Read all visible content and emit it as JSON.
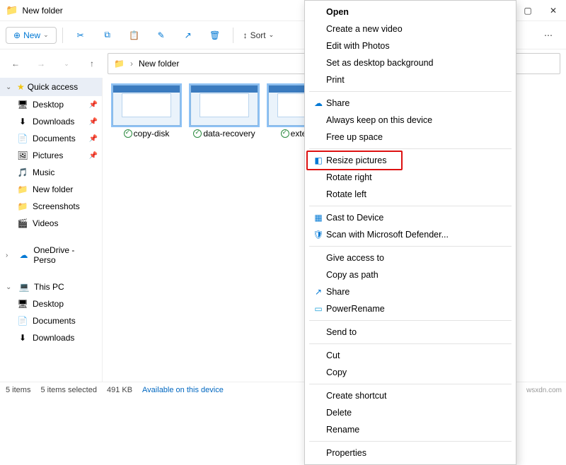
{
  "titlebar": {
    "title": "New folder"
  },
  "toolbar": {
    "new_label": "New",
    "sort_label": "Sort"
  },
  "breadcrumb": {
    "label": "New folder"
  },
  "sidebar": {
    "quick_access": "Quick access",
    "items": [
      {
        "label": "Desktop"
      },
      {
        "label": "Downloads"
      },
      {
        "label": "Documents"
      },
      {
        "label": "Pictures"
      },
      {
        "label": "Music"
      },
      {
        "label": "New folder"
      },
      {
        "label": "Screenshots"
      },
      {
        "label": "Videos"
      }
    ],
    "onedrive": "OneDrive - Perso",
    "thispc": "This PC",
    "pc_items": [
      {
        "label": "Desktop"
      },
      {
        "label": "Documents"
      },
      {
        "label": "Downloads"
      }
    ]
  },
  "files": [
    {
      "name": "copy-disk"
    },
    {
      "name": "data-recovery"
    },
    {
      "name": "extend-n"
    }
  ],
  "status": {
    "count": "5 items",
    "sel": "5 items selected",
    "size": "491 KB",
    "avail": "Available on this device"
  },
  "watermark": "wsxdn.com",
  "ctx": {
    "open": "Open",
    "create_video": "Create a new video",
    "edit_photos": "Edit with Photos",
    "set_bg": "Set as desktop background",
    "print": "Print",
    "share": "Share",
    "always_keep": "Always keep on this device",
    "free_up": "Free up space",
    "resize": "Resize pictures",
    "rotate_right": "Rotate right",
    "rotate_left": "Rotate left",
    "cast": "Cast to Device",
    "scan": "Scan with Microsoft Defender...",
    "give_access": "Give access to",
    "copy_path": "Copy as path",
    "share2": "Share",
    "power_rename": "PowerRename",
    "send_to": "Send to",
    "cut": "Cut",
    "copy": "Copy",
    "create_shortcut": "Create shortcut",
    "delete": "Delete",
    "rename": "Rename",
    "properties": "Properties"
  }
}
